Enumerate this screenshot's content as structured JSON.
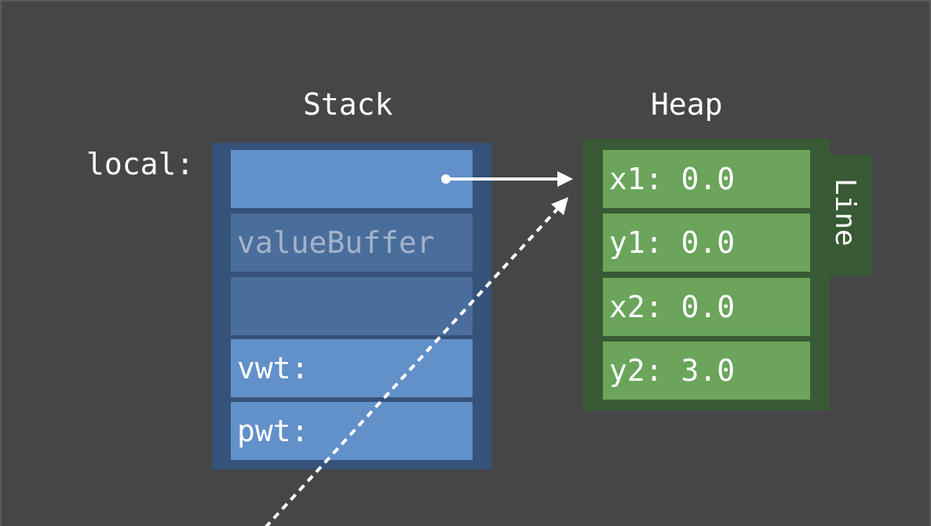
{
  "titles": {
    "stack": "Stack",
    "heap": "Heap"
  },
  "local_label": "local:",
  "stack": {
    "cells": [
      "",
      "valueBuffer",
      "",
      "vwt:",
      "pwt:"
    ]
  },
  "heap": {
    "object_type": "Line",
    "fields": [
      "x1: 0.0",
      "y1: 0.0",
      "x2: 0.0",
      "y2: 3.0"
    ]
  },
  "colors": {
    "background": "#464649",
    "stack_frame": "#35527a",
    "stack_cell": "#6290c9",
    "stack_cell_dim": "#4a6e9c",
    "heap_frame": "#385a34",
    "heap_cell": "#6aa55b",
    "arrow": "#ffffff"
  }
}
